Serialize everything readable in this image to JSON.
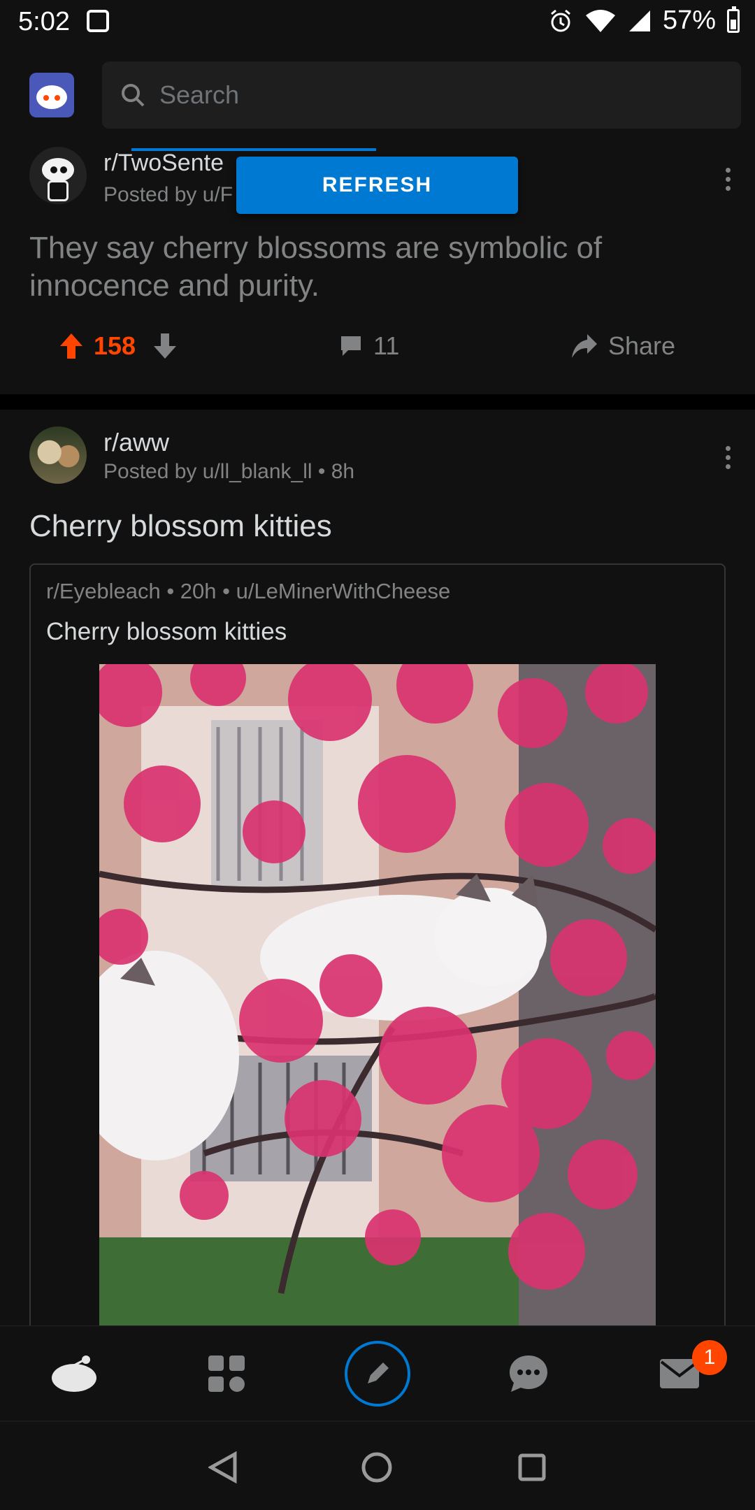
{
  "status_bar": {
    "time": "5:02",
    "battery": "57%"
  },
  "search": {
    "placeholder": "Search"
  },
  "post1": {
    "subreddit": "r/TwoSente",
    "posted_by": "Posted by u/F",
    "title": "They say cherry blossoms are symbolic of innocence and purity.",
    "refresh_label": "REFRESH",
    "votes": "158",
    "comments": "11",
    "share_label": "Share"
  },
  "post2": {
    "subreddit": "r/aww",
    "posted_by": "Posted by u/ll_blank_ll • 8h",
    "title": "Cherry blossom kitties",
    "crosspost": {
      "meta": "r/Eyebleach • 20h • u/LeMinerWithCheese",
      "title": "Cherry blossom kitties"
    }
  },
  "bottom_nav": {
    "items": [
      "home-icon",
      "communities-icon",
      "create-post-icon",
      "chat-icon",
      "inbox-icon"
    ],
    "inbox_badge": "1"
  },
  "colors": {
    "accent": "#0079d3",
    "upvote": "#ff4500",
    "background": "#111111",
    "muted_text": "#818384"
  }
}
